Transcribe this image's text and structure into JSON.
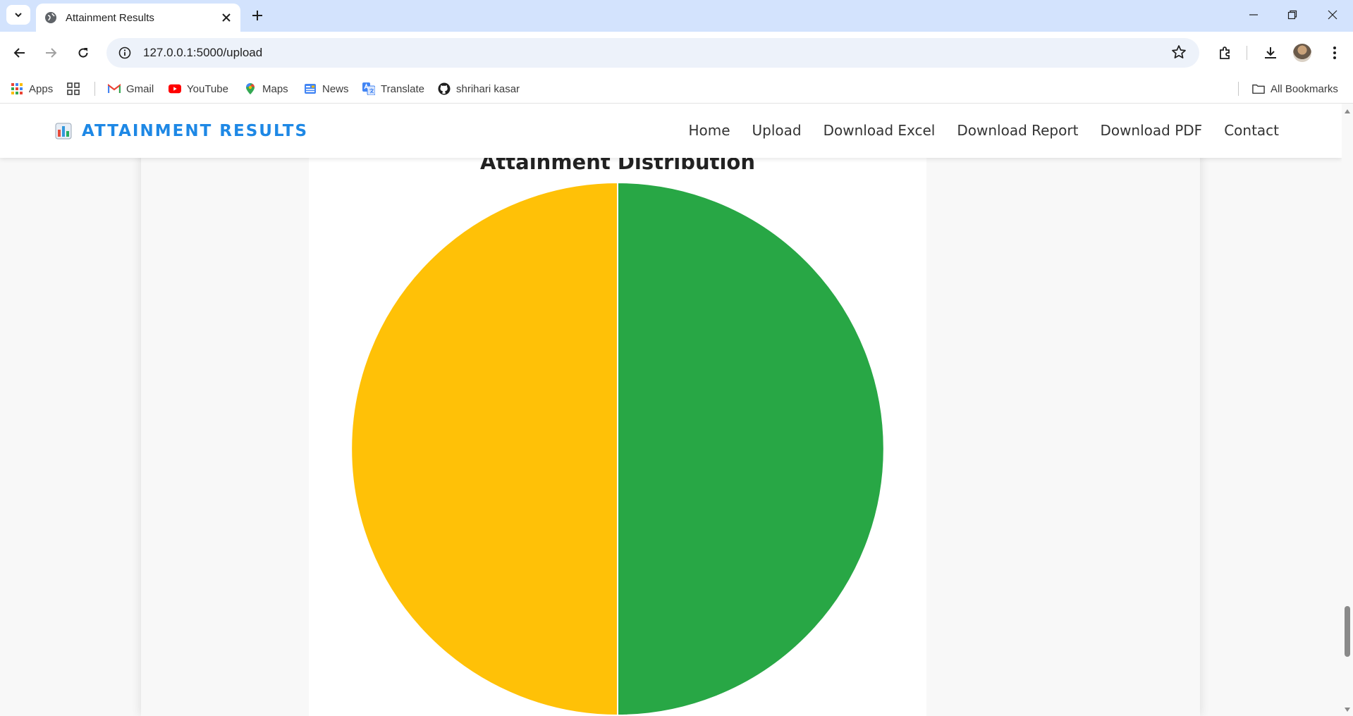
{
  "browser": {
    "tab": {
      "title": "Attainment Results"
    },
    "url": "127.0.0.1:5000/upload",
    "bookmarks": [
      {
        "label": "Apps",
        "icon": "apps-grid-icon"
      },
      {
        "label": "",
        "icon": "tab-groups-icon"
      },
      {
        "label": "Gmail",
        "icon": "gmail-icon"
      },
      {
        "label": "YouTube",
        "icon": "youtube-icon"
      },
      {
        "label": "Maps",
        "icon": "maps-icon"
      },
      {
        "label": "News",
        "icon": "news-icon"
      },
      {
        "label": "Translate",
        "icon": "translate-icon"
      },
      {
        "label": "shrihari kasar",
        "icon": "github-icon"
      }
    ],
    "all_bookmarks_label": "All Bookmarks"
  },
  "navbar": {
    "brand": "ATTAINMENT RESULTS",
    "brand_icon": "bar-chart-icon",
    "links": [
      "Home",
      "Upload",
      "Download Excel",
      "Download Report",
      "Download PDF",
      "Contact"
    ],
    "brand_color": "#1e88e5"
  },
  "chart_data": {
    "type": "pie",
    "title": "Attainment Distribution",
    "slices": [
      {
        "value": 50,
        "color": "#28a745"
      },
      {
        "value": 50,
        "color": "#ffc107"
      }
    ]
  }
}
